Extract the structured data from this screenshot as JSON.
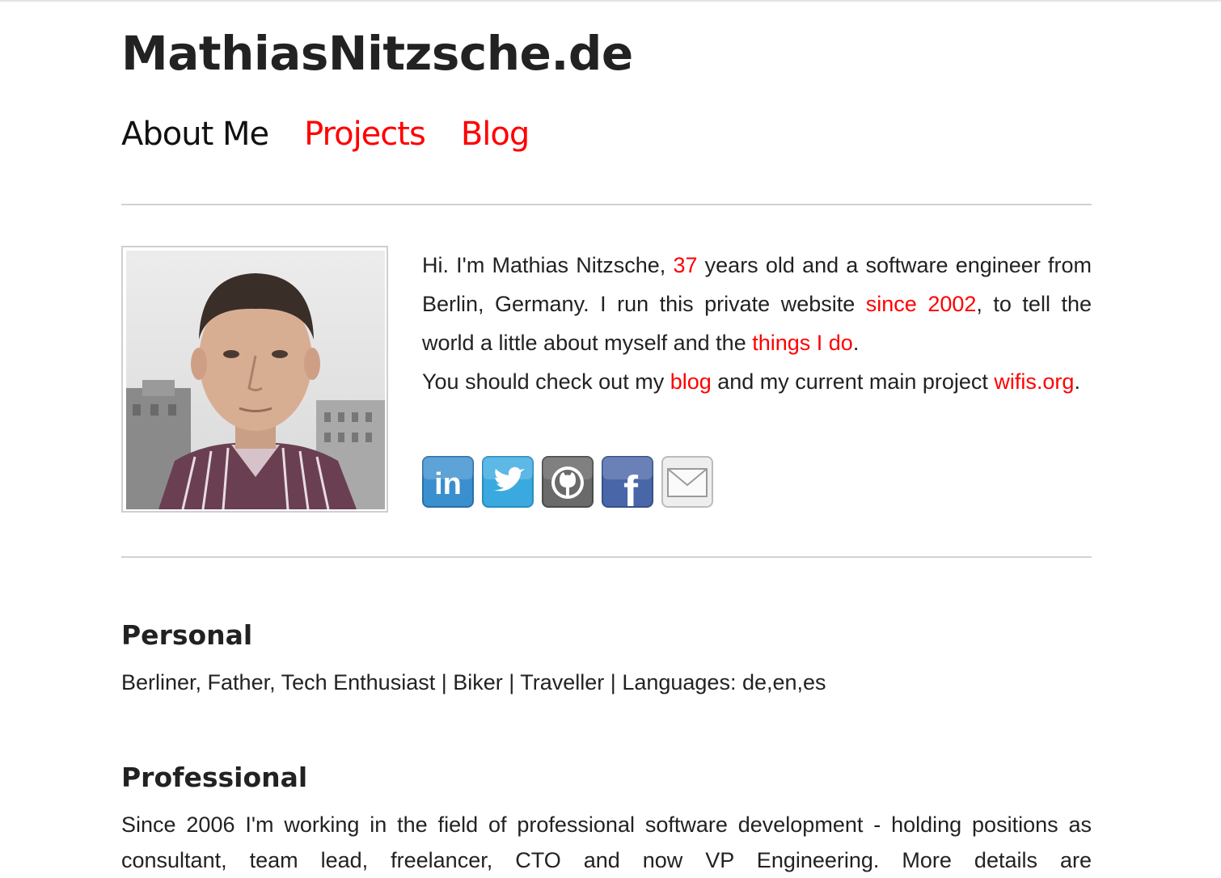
{
  "site": {
    "title": "MathiasNitzsche.de"
  },
  "nav": {
    "items": [
      {
        "label": "About Me",
        "current": true
      },
      {
        "label": "Projects"
      },
      {
        "label": "Blog"
      }
    ]
  },
  "intro": {
    "s1": "Hi. I'm Mathias Nitzsche, ",
    "age_link": "37",
    "s2": " years old and a software engineer from Berlin, Germany. I run this private website ",
    "since_link": "since 2002",
    "s3": ", to tell the world a little about myself and the ",
    "things_link": "things I do",
    "s4": ".",
    "s5": "You should check out my ",
    "blog_link": "blog",
    "s6": " and my current main project ",
    "wifis_link": "wifis.org",
    "s7": "."
  },
  "social": {
    "icons": [
      {
        "name": "linkedin-icon",
        "text": "in",
        "color": "#3a8fcf"
      },
      {
        "name": "twitter-icon",
        "color": "#3aa9e0"
      },
      {
        "name": "github-icon",
        "color": "#6a6a6a"
      },
      {
        "name": "facebook-icon",
        "text": "f",
        "color": "#4866a8"
      },
      {
        "name": "email-icon",
        "color": "#eeeeee"
      }
    ]
  },
  "personal": {
    "title": "Personal",
    "text": "Berliner, Father, Tech Enthusiast | Biker | Traveller | Languages: de,en,es"
  },
  "professional": {
    "title": "Professional",
    "text": "Since 2006 I'm working in the field of professional software development - holding positions as consultant, team lead, freelancer, CTO and now VP Engineering. More details are"
  },
  "colors": {
    "link": "#ff0000",
    "text": "#222222",
    "rule": "#d2d2d2"
  }
}
